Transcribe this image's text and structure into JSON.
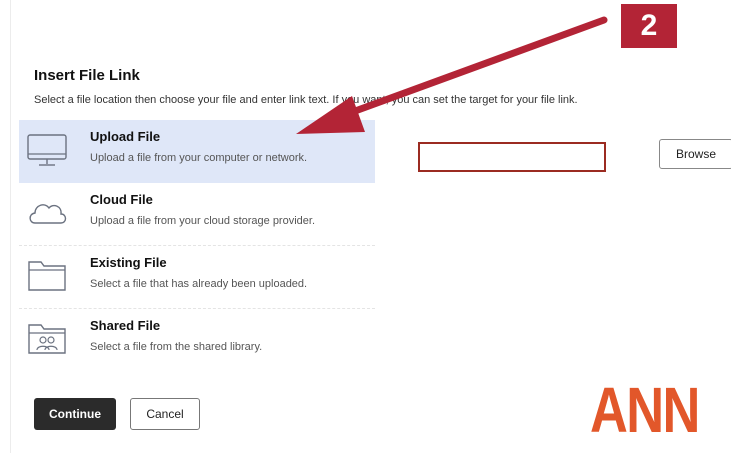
{
  "annotation": {
    "step_number": "2",
    "color": "#b32436"
  },
  "dialog": {
    "title": "Insert File Link",
    "description": "Select a file location then choose your file and enter link text. If you want, you can set the target for your file link."
  },
  "options": [
    {
      "title": "Upload File",
      "description": "Upload a file from your computer or network.",
      "icon": "desktop-icon",
      "selected": true
    },
    {
      "title": "Cloud File",
      "description": "Upload a file from your cloud storage provider.",
      "icon": "cloud-icon",
      "selected": false
    },
    {
      "title": "Existing File",
      "description": "Select a file that has already been uploaded.",
      "icon": "folder-icon",
      "selected": false
    },
    {
      "title": "Shared File",
      "description": "Select a file from the shared library.",
      "icon": "shared-folder-icon",
      "selected": false
    }
  ],
  "upload": {
    "file_value": "",
    "browse_label": "Browse"
  },
  "actions": {
    "continue_label": "Continue",
    "cancel_label": "Cancel"
  },
  "brand": {
    "text": "ANN",
    "color": "#e2572a"
  },
  "colors": {
    "selected_row": "#dfe7f8",
    "primary_button": "#2b2b2b",
    "input_border": "#9b2b21"
  }
}
